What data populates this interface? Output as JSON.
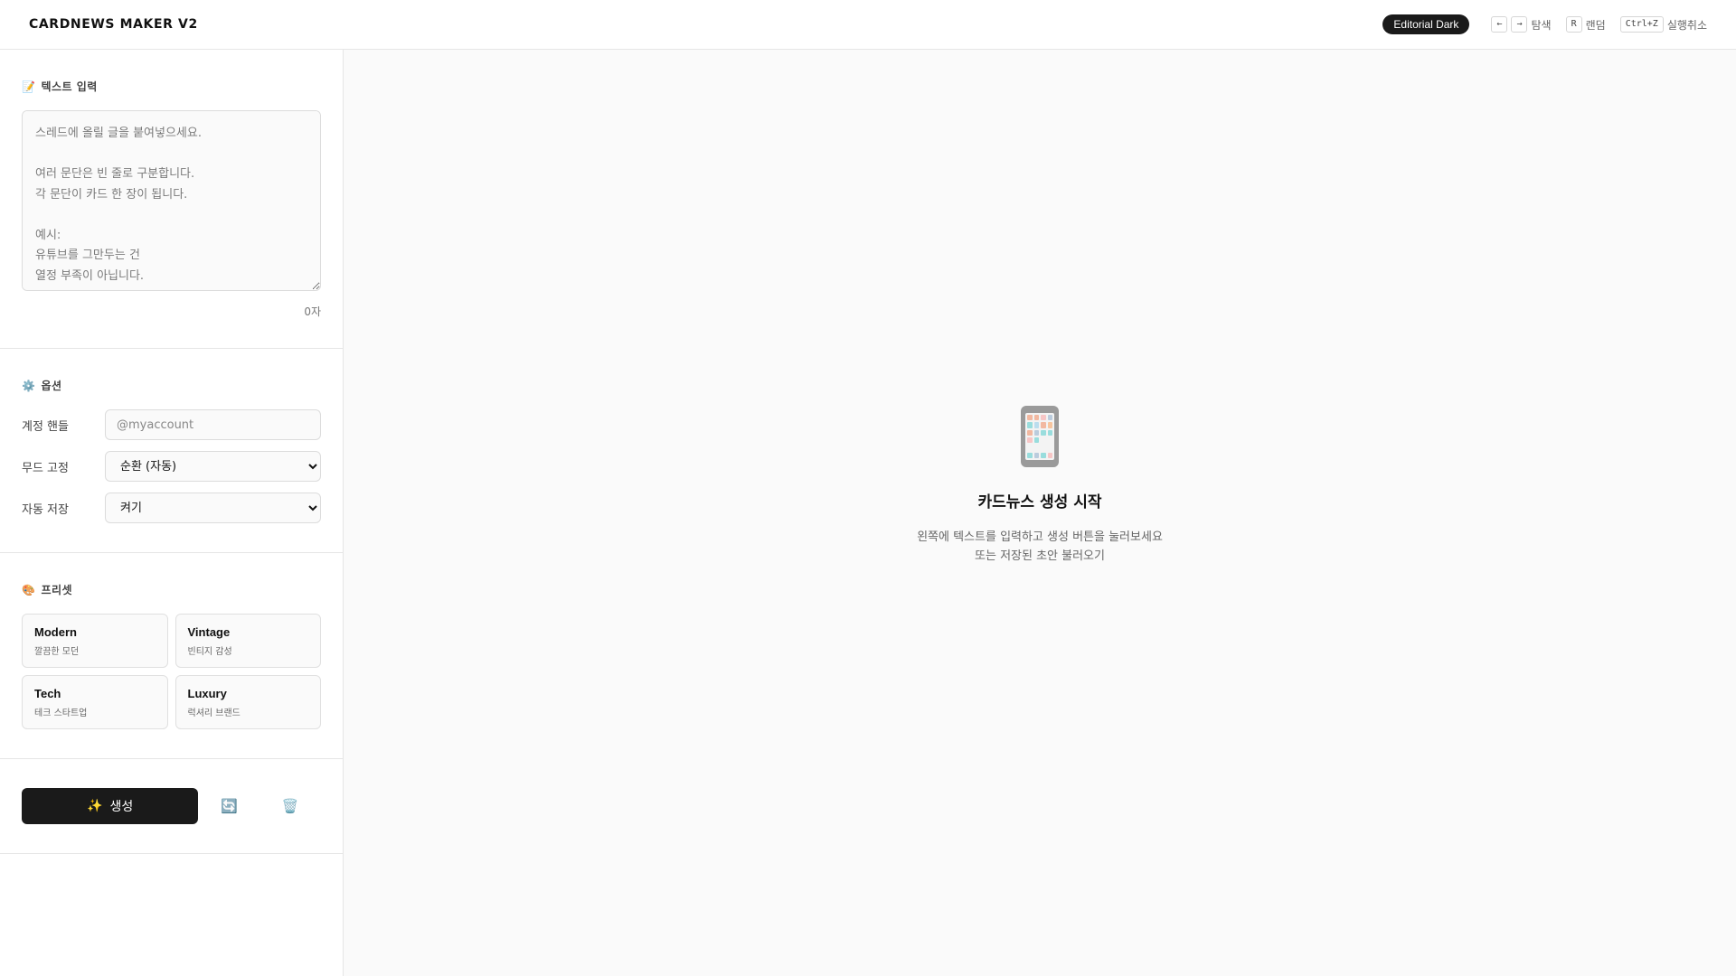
{
  "header": {
    "brand": "CARDNEWS MAKER V2",
    "theme": "Editorial Dark",
    "shortcuts": [
      {
        "keys": [
          "←",
          "→"
        ],
        "label": "탐색"
      },
      {
        "keys": [
          "R"
        ],
        "label": "랜덤"
      },
      {
        "keys": [
          "Ctrl+Z"
        ],
        "label": "실행취소"
      }
    ]
  },
  "text_input": {
    "emoji": "📝",
    "title": "텍스트 입력",
    "placeholder": "스레드에 올릴 글을 붙여넣으세요.\n\n여러 문단은 빈 줄로 구분합니다.\n각 문단이 카드 한 장이 됩니다.\n\n예시:\n유튜브를 그만두는 건\n열정 부족이 아닙니다.",
    "value": "",
    "char_count": "0자"
  },
  "options": {
    "emoji": "⚙️",
    "title": "옵션",
    "handle_label": "계정 핸들",
    "handle_placeholder": "@myaccount",
    "mood_label": "무드 고정",
    "mood_value": "순환 (자동)",
    "autosave_label": "자동 저장",
    "autosave_value": "켜기"
  },
  "presets": {
    "emoji": "🎨",
    "title": "프리셋",
    "items": [
      {
        "name": "Modern",
        "desc": "깔끔한 모던"
      },
      {
        "name": "Vintage",
        "desc": "빈티지 감성"
      },
      {
        "name": "Tech",
        "desc": "테크 스타트업"
      },
      {
        "name": "Luxury",
        "desc": "럭셔리 브랜드"
      }
    ]
  },
  "actions": {
    "generate_emoji": "✨",
    "generate_label": "생성",
    "refresh_icon": "🔄",
    "delete_icon": "🗑️"
  },
  "empty_state": {
    "title": "카드뉴스 생성 시작",
    "line1": "왼쪽에 텍스트를 입력하고 생성 버튼을 눌러보세요",
    "line2": "또는 저장된 초안 불러오기"
  },
  "colors": {
    "accent": "#1a1a1a",
    "background": "#fafafa"
  }
}
